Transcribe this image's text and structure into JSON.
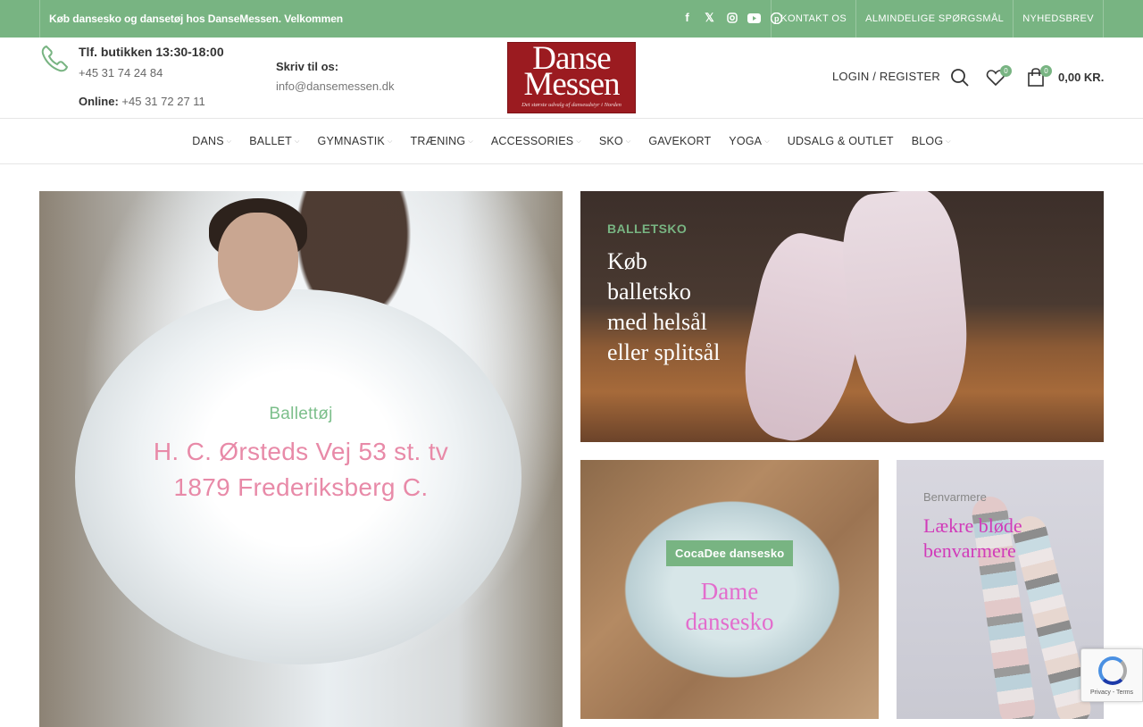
{
  "topbar": {
    "welcome": "Køb dansesko og dansetøj hos DanseMessen. Velkommen",
    "socials": [
      "facebook-icon",
      "x-icon",
      "instagram-icon",
      "youtube-icon",
      "pinterest-icon"
    ],
    "links": [
      "KONTAKT OS",
      "ALMINDELIGE SPØRGSMÅL",
      "NYHEDSBREV"
    ]
  },
  "header": {
    "store_hours": "Tlf. butikken 13:30-18:00",
    "phone": "+45 31 74 24 84",
    "online_label": "Online:",
    "online_phone": "+45 31 72 27 11",
    "write_label": "Skriv til os:",
    "email": "info@dansemessen.dk",
    "logo_line1": "Danse",
    "logo_line2": "Messen",
    "logo_tagline": "Det største udvalg af danseudstyr i Norden",
    "login": "LOGIN / REGISTER",
    "wishlist_count": "0",
    "cart_count": "0",
    "cart_total": "0,00 KR."
  },
  "nav": {
    "items": [
      {
        "label": "DANS",
        "has_dropdown": true
      },
      {
        "label": "BALLET",
        "has_dropdown": true
      },
      {
        "label": "GYMNASTIK",
        "has_dropdown": true
      },
      {
        "label": "TRÆNING",
        "has_dropdown": true
      },
      {
        "label": "ACCESSORIES",
        "has_dropdown": true
      },
      {
        "label": "SKO",
        "has_dropdown": true
      },
      {
        "label": "GAVEKORT",
        "has_dropdown": false
      },
      {
        "label": "YOGA",
        "has_dropdown": true
      },
      {
        "label": "UDSALG & OUTLET",
        "has_dropdown": false
      },
      {
        "label": "BLOG",
        "has_dropdown": true
      }
    ]
  },
  "banners": {
    "left": {
      "category": "Ballettøj",
      "line1": "H. C. Ørsteds Vej 53 st. tv",
      "line2": "1879 Frederiksberg C."
    },
    "top": {
      "category": "BALLETSKO",
      "title_lines": [
        "Køb",
        "balletsko",
        "med helsål",
        "eller splitsål"
      ]
    },
    "mid": {
      "tag": "CocaDee dansesko",
      "title_lines": [
        "Dame",
        "dansesko"
      ]
    },
    "right": {
      "category": "Benvarmere",
      "title_lines": [
        "Lækre bløde",
        "benvarmere"
      ]
    }
  },
  "recaptcha": {
    "text": "Privacy - Terms"
  },
  "colors": {
    "accent": "#78b482",
    "logo": "#9b1b20",
    "pink": "#e88aa8",
    "magenta": "#d13bb9"
  }
}
